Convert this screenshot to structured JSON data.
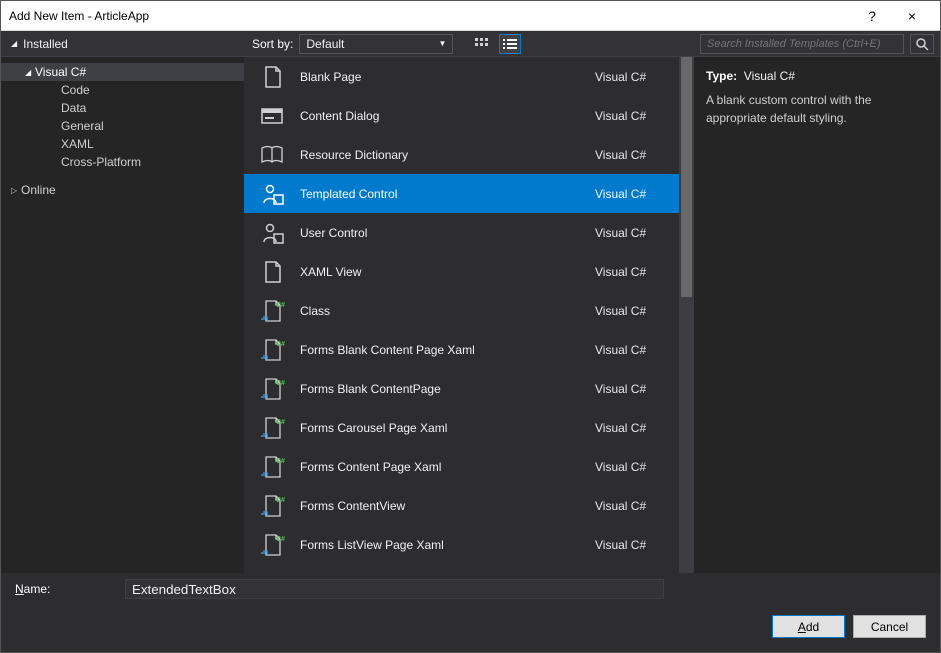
{
  "window": {
    "title": "Add New Item - ArticleApp",
    "help": "?",
    "close": "×"
  },
  "sidebar": {
    "header": "Installed",
    "nodes": [
      {
        "label": "Visual C#",
        "level": 1,
        "chev": "◢",
        "selected": true
      },
      {
        "label": "Code",
        "level": 2
      },
      {
        "label": "Data",
        "level": 2
      },
      {
        "label": "General",
        "level": 2
      },
      {
        "label": "XAML",
        "level": 2
      },
      {
        "label": "Cross-Platform",
        "level": 2
      },
      {
        "label": "Online",
        "level": 0,
        "chev": "▷"
      }
    ]
  },
  "toolbar": {
    "sort_label": "Sort by:",
    "sort_value": "Default"
  },
  "templates": [
    {
      "name": "Blank Page",
      "lang": "Visual C#",
      "icon": "doc"
    },
    {
      "name": "Content Dialog",
      "lang": "Visual C#",
      "icon": "dialog"
    },
    {
      "name": "Resource Dictionary",
      "lang": "Visual C#",
      "icon": "book"
    },
    {
      "name": "Templated Control",
      "lang": "Visual C#",
      "icon": "control",
      "selected": true
    },
    {
      "name": "User Control",
      "lang": "Visual C#",
      "icon": "control"
    },
    {
      "name": "XAML View",
      "lang": "Visual C#",
      "icon": "doc"
    },
    {
      "name": "Class",
      "lang": "Visual C#",
      "icon": "csdoc"
    },
    {
      "name": "Forms Blank Content Page Xaml",
      "lang": "Visual C#",
      "icon": "csdoc"
    },
    {
      "name": "Forms Blank ContentPage",
      "lang": "Visual C#",
      "icon": "csdoc"
    },
    {
      "name": "Forms Carousel Page Xaml",
      "lang": "Visual C#",
      "icon": "csdoc"
    },
    {
      "name": "Forms Content Page Xaml",
      "lang": "Visual C#",
      "icon": "csdoc"
    },
    {
      "name": "Forms ContentView",
      "lang": "Visual C#",
      "icon": "csdoc"
    },
    {
      "name": "Forms ListView Page Xaml",
      "lang": "Visual C#",
      "icon": "csdoc"
    }
  ],
  "details": {
    "search_placeholder": "Search Installed Templates (Ctrl+E)",
    "type_label": "Type:",
    "type_value": "Visual C#",
    "description": "A blank custom control with the appropriate default styling."
  },
  "footer": {
    "name_label": "Name:",
    "name_value": "ExtendedTextBox",
    "add": "Add",
    "cancel": "Cancel"
  }
}
